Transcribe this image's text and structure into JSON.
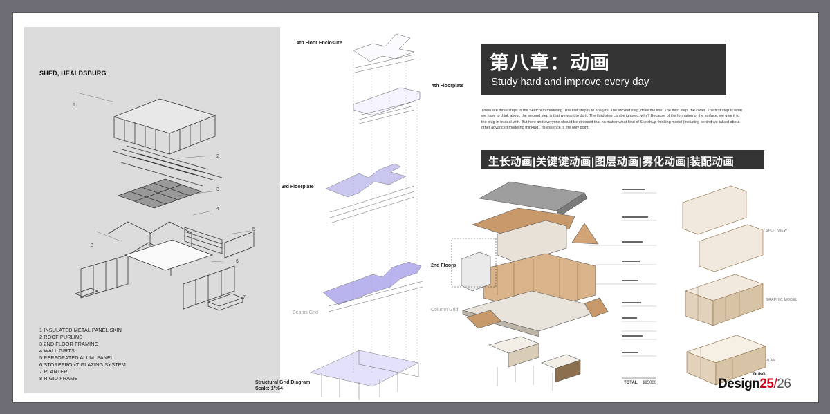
{
  "left_panel": {
    "title": "SHED, HEALDSBURG",
    "callouts": [
      "1",
      "2",
      "3",
      "4",
      "5",
      "6",
      "7",
      "8"
    ],
    "legend": [
      "1 INSULATED METAL PANEL SKIN",
      "2 ROOF PURLINS",
      "3 2ND FLOOR FRAMING",
      "4 WALL GIRTS",
      "5 PERFORATED ALUM. PANEL",
      "6 STOREFRONT GLAZING SYSTEM",
      "7 PLANTER",
      "8 RIGID FRAME"
    ]
  },
  "middle": {
    "fourth_enclosure": "4th Floor Enclosure",
    "fourth_floorplate": "4th Floorplate",
    "third_floorplate": "3rd Floorplate",
    "second_floorplate": "2nd Floorp",
    "beams_grid": "Beams Grid",
    "column_grid": "Column Grid",
    "structural_title": "Structural Grid Diagram",
    "scale": "Scale: 1\":64"
  },
  "right": {
    "title_main": "第八章：动画",
    "title_sub": "Study hard and improve every day",
    "paragraph": "There are three steps in the SketchUp modeling. The first step is to analyze. The second step, draw the line. The third step, the cover. The first step is what we have to think about, the second step is that we want to do it. The third step can be ignored, why? Because of the formation of the surface, we give it to the plug-in to deal with. But here and everyone should be stressed that no matter what kind of SketchUp thinking model (including behind we talked about other advanced modeling thinking), its essence is the only point.",
    "animation_types": "生长动画|关键键动画|图层动画|雾化动画|装配动画",
    "total_label": "TOTAL",
    "total_value": "$95000",
    "side_notes": [
      "SPLIT VIEW",
      "GRAPHIC MODEL",
      "PLAN"
    ]
  },
  "brand": {
    "sup": "DUNG",
    "word": "Design",
    "num": "25",
    "slash": "/",
    "den": "26"
  },
  "colors": {
    "background": "#6e6d76",
    "panel": "#dcdcdc",
    "title_box": "#333333",
    "floorplate": "#c9c6f0",
    "wood": "#c8996a",
    "brand_red": "#d5001c"
  }
}
